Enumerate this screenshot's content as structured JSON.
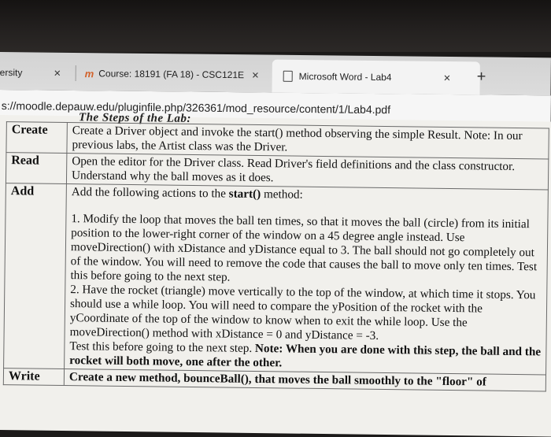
{
  "browser": {
    "tabs": [
      {
        "label": "ersity",
        "close": "×"
      },
      {
        "label": "Course: 18191 (FA 18) - CSC121E",
        "close": "×"
      },
      {
        "label": "Microsoft Word - Lab4",
        "close": "×"
      }
    ],
    "new_tab": "+",
    "url": "s://moodle.depauw.edu/pluginfile.php/326361/mod_resource/content/1/Lab4.pdf",
    "course_logo": "m"
  },
  "document": {
    "heading": "The Steps of the Lab:",
    "rows": [
      {
        "step": "Create",
        "text": "Create a Driver object and invoke the start() method observing the simple Result. Note: In our previous labs, the Artist class was the Driver."
      },
      {
        "step": "Read",
        "text": "Open the editor for the Driver class. Read Driver's field definitions and the class constructor. Understand why the ball moves as it does."
      },
      {
        "step": "Add",
        "intro_pre": "Add the following actions to the ",
        "intro_bold": "start()",
        "intro_post": " method:",
        "item1": "1. Modify the loop that moves the ball ten times, so that it moves the ball (circle) from its initial position to the lower-right corner of the window on a 45 degree angle instead. Use moveDirection() with xDistance and yDistance equal to 3. The ball should not go completely out of the window. You will need to remove the code that causes the ball to move only ten times. Test this before going to the next step.",
        "item2": "2. Have the rocket (triangle) move vertically to the top of the window, at which time it stops. You should use a while loop. You will need to compare the yPosition of the rocket with the yCoordinate of the top of the window to know when to exit the while loop. Use the moveDirection() method with xDistance = 0 and yDistance = -3.",
        "item2_test": "Test this before going to the next step. ",
        "item2_note": "Note: When you are done with this step, the ball and the rocket will both move, one after the other."
      },
      {
        "step": "Write",
        "text": "Create a new method, bounceBall(), that moves the ball smoothly to the \"floor\" of"
      }
    ]
  }
}
